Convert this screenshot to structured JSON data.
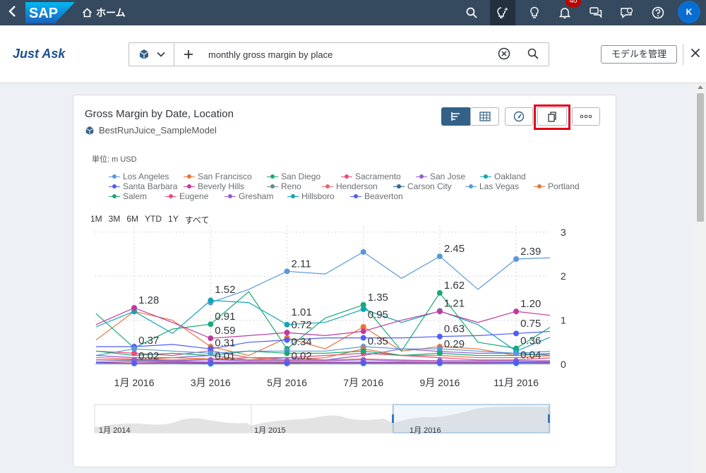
{
  "shell": {
    "logo_text": "SAP",
    "home_label": "ホーム",
    "notification_count": "40",
    "avatar_initial": "K"
  },
  "header": {
    "title": "Just Ask",
    "query": "monthly gross margin by place",
    "manage_button": "モデルを管理"
  },
  "card": {
    "title": "Gross Margin by Date, Location",
    "model_name": "BestRunJuice_SampleModel",
    "unit": "単位: m USD",
    "time_ranges": [
      "1M",
      "3M",
      "6M",
      "YTD",
      "1Y",
      "すべて"
    ]
  },
  "legend": [
    {
      "name": "Los Angeles",
      "color": "#5899da"
    },
    {
      "name": "San Francisco",
      "color": "#e8743b"
    },
    {
      "name": "San Diego",
      "color": "#19a979"
    },
    {
      "name": "Sacramento",
      "color": "#ed4a7b"
    },
    {
      "name": "San Jose",
      "color": "#945ecf"
    },
    {
      "name": "Oakland",
      "color": "#13a4b4"
    },
    {
      "name": "Santa Barbara",
      "color": "#525df4"
    },
    {
      "name": "Beverly Hills",
      "color": "#bf399e"
    },
    {
      "name": "Reno",
      "color": "#6c8893"
    },
    {
      "name": "Henderson",
      "color": "#ee6868"
    },
    {
      "name": "Carson City",
      "color": "#2f6497"
    },
    {
      "name": "Las Vegas",
      "color": "#5899da"
    },
    {
      "name": "Portland",
      "color": "#e8743b"
    },
    {
      "name": "Salem",
      "color": "#19a979"
    },
    {
      "name": "Eugene",
      "color": "#ed4a7b"
    },
    {
      "name": "Gresham",
      "color": "#945ecf"
    },
    {
      "name": "Hillsboro",
      "color": "#13a4b4"
    },
    {
      "name": "Beaverton",
      "color": "#525df4"
    }
  ],
  "chart_data": {
    "type": "line",
    "x": [
      "2015-12",
      "2016-01",
      "2016-02",
      "2016-03",
      "2016-04",
      "2016-05",
      "2016-06",
      "2016-07",
      "2016-08",
      "2016-09",
      "2016-10",
      "2016-11",
      "2016-12"
    ],
    "x_tick_labels": [
      "1月 2016",
      "3月 2016",
      "5月 2016",
      "7月 2016",
      "9月 2016",
      "11月 2016"
    ],
    "y_tick_labels": [
      "0",
      "1",
      "2",
      "3"
    ],
    "ylim": [
      0,
      3
    ],
    "grid": true,
    "series": [
      {
        "name": "Los Angeles",
        "color": "#5899da",
        "values": [
          null,
          null,
          null,
          1.4,
          1.7,
          2.11,
          2.05,
          2.55,
          1.95,
          2.45,
          1.7,
          2.39,
          2.42
        ]
      },
      {
        "name": "San Francisco",
        "color": "#e8743b",
        "values": [
          0.55,
          1.2,
          1.0,
          0.4,
          0.2,
          0.6,
          0.35,
          0.85,
          0.3,
          0.4,
          0.35,
          0.2,
          0.25
        ]
      },
      {
        "name": "San Diego",
        "color": "#19a979",
        "values": [
          1.15,
          0.37,
          0.8,
          0.91,
          1.65,
          0.35,
          1.05,
          1.35,
          0.3,
          1.62,
          0.5,
          0.36,
          0.9
        ]
      },
      {
        "name": "Sacramento",
        "color": "#ed4a7b",
        "values": [
          0.3,
          0.25,
          0.2,
          0.31,
          0.15,
          0.15,
          0.2,
          0.25,
          0.2,
          0.15,
          0.1,
          0.1,
          0.15
        ]
      },
      {
        "name": "San Jose",
        "color": "#945ecf",
        "values": [
          0.2,
          0.15,
          0.15,
          0.2,
          0.1,
          0.15,
          0.1,
          0.2,
          0.35,
          0.29,
          0.25,
          0.25,
          0.2
        ]
      },
      {
        "name": "Oakland",
        "color": "#13a4b4",
        "values": [
          0.85,
          1.2,
          0.7,
          1.45,
          1.4,
          0.9,
          0.95,
          1.25,
          0.95,
          1.21,
          0.9,
          0.3,
          0.65
        ]
      },
      {
        "name": "Santa Barbara",
        "color": "#525df4",
        "values": [
          0.4,
          0.4,
          0.45,
          0.35,
          0.5,
          0.55,
          0.6,
          0.6,
          0.6,
          0.63,
          0.65,
          0.7,
          0.75
        ]
      },
      {
        "name": "Beverly Hills",
        "color": "#bf399e",
        "values": [
          0.9,
          1.28,
          0.95,
          0.59,
          0.65,
          0.72,
          0.65,
          0.75,
          1.0,
          1.2,
          0.95,
          1.2,
          1.1
        ]
      },
      {
        "name": "Reno",
        "color": "#6c8893",
        "values": [
          0.1,
          0.08,
          0.07,
          0.05,
          0.05,
          0.02,
          0.04,
          0.05,
          0.05,
          0.04,
          0.03,
          0.04,
          0.03
        ]
      },
      {
        "name": "Henderson",
        "color": "#ee6868",
        "values": [
          0.15,
          0.12,
          0.1,
          0.12,
          0.1,
          0.1,
          0.1,
          0.12,
          0.1,
          0.08,
          0.08,
          0.08,
          0.06
        ]
      },
      {
        "name": "Carson City",
        "color": "#2f6497",
        "values": [
          0.05,
          0.05,
          0.04,
          0.02,
          0.03,
          0.03,
          0.03,
          0.04,
          0.04,
          0.03,
          0.02,
          0.03,
          0.03
        ]
      },
      {
        "name": "Las Vegas",
        "color": "#5899da",
        "values": [
          0.2,
          0.35,
          0.3,
          0.25,
          0.3,
          0.3,
          0.3,
          0.4,
          0.35,
          0.35,
          0.3,
          0.25,
          0.3
        ]
      },
      {
        "name": "Portland",
        "color": "#e8743b",
        "values": [
          0.1,
          0.1,
          0.15,
          0.12,
          0.15,
          0.1,
          0.15,
          0.35,
          0.2,
          0.2,
          0.15,
          0.15,
          0.2
        ]
      },
      {
        "name": "Salem",
        "color": "#19a979",
        "values": [
          0.3,
          0.2,
          0.25,
          0.2,
          0.3,
          0.25,
          0.25,
          0.3,
          0.2,
          0.25,
          0.2,
          0.2,
          0.25
        ]
      },
      {
        "name": "Eugene",
        "color": "#ed4a7b",
        "values": [
          0.05,
          0.05,
          0.05,
          0.05,
          0.05,
          0.05,
          0.05,
          0.05,
          0.05,
          0.05,
          0.05,
          0.05,
          0.05
        ]
      },
      {
        "name": "Gresham",
        "color": "#945ecf",
        "values": [
          0.1,
          0.1,
          0.08,
          0.1,
          0.08,
          0.08,
          0.08,
          0.1,
          0.08,
          0.08,
          0.08,
          0.08,
          0.08
        ]
      },
      {
        "name": "Hillsboro",
        "color": "#13a4b4",
        "values": [
          0.02,
          0.02,
          0.02,
          0.01,
          0.02,
          0.02,
          0.02,
          0.02,
          0.02,
          0.02,
          0.02,
          0.02,
          0.02
        ]
      },
      {
        "name": "Beaverton",
        "color": "#525df4",
        "values": [
          0.04,
          0.02,
          0.03,
          0.03,
          0.03,
          0.02,
          0.03,
          0.03,
          0.03,
          0.03,
          0.03,
          0.04,
          0.03
        ]
      }
    ],
    "data_labels": [
      {
        "x": "2016-01",
        "value": 1.28,
        "text": "1.28"
      },
      {
        "x": "2016-01",
        "value": 0.37,
        "text": "0.37"
      },
      {
        "x": "2016-01",
        "value": 0.02,
        "text": "0.02"
      },
      {
        "x": "2016-03",
        "value": 1.52,
        "text": "1.52"
      },
      {
        "x": "2016-03",
        "value": 0.91,
        "text": "0.91"
      },
      {
        "x": "2016-03",
        "value": 0.59,
        "text": "0.59"
      },
      {
        "x": "2016-03",
        "value": 0.31,
        "text": "0.31"
      },
      {
        "x": "2016-03",
        "value": 0.01,
        "text": "0.01"
      },
      {
        "x": "2016-05",
        "value": 2.11,
        "text": "2.11"
      },
      {
        "x": "2016-05",
        "value": 1.01,
        "text": "1.01"
      },
      {
        "x": "2016-05",
        "value": 0.72,
        "text": "0.72"
      },
      {
        "x": "2016-05",
        "value": 0.34,
        "text": "0.34"
      },
      {
        "x": "2016-05",
        "value": 0.02,
        "text": "0.02"
      },
      {
        "x": "2016-07",
        "value": 1.35,
        "text": "1.35"
      },
      {
        "x": "2016-07",
        "value": 0.95,
        "text": "0.95"
      },
      {
        "x": "2016-07",
        "value": 0.35,
        "text": "0.35"
      },
      {
        "x": "2016-09",
        "value": 2.45,
        "text": "2.45"
      },
      {
        "x": "2016-09",
        "value": 1.62,
        "text": "1.62"
      },
      {
        "x": "2016-09",
        "value": 1.21,
        "text": "1.21"
      },
      {
        "x": "2016-09",
        "value": 0.63,
        "text": "0.63"
      },
      {
        "x": "2016-09",
        "value": 0.29,
        "text": "0.29"
      },
      {
        "x": "2016-11",
        "value": 2.39,
        "text": "2.39"
      },
      {
        "x": "2016-11",
        "value": 1.2,
        "text": "1.20"
      },
      {
        "x": "2016-11",
        "value": 0.75,
        "text": "0.75"
      },
      {
        "x": "2016-11",
        "value": 0.36,
        "text": "0.36"
      },
      {
        "x": "2016-11",
        "value": 0.04,
        "text": "0.04"
      }
    ],
    "navigator_labels": [
      "1月 2014",
      "1月 2015",
      "1月 2016"
    ]
  }
}
